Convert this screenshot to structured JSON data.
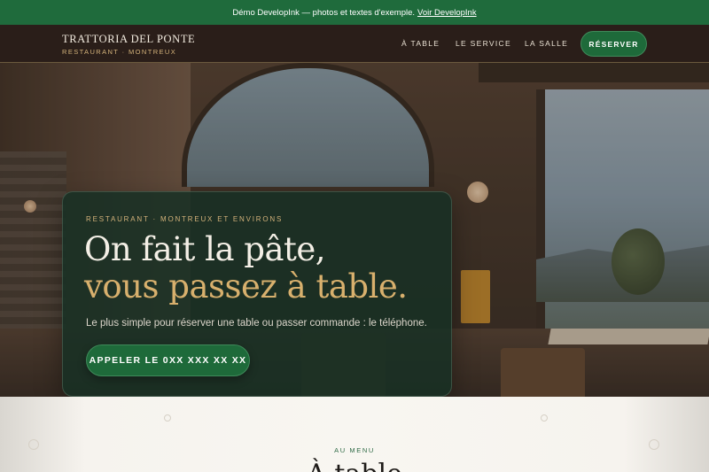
{
  "demo_banner": {
    "text": "Démo DevelopInk — photos et textes d'exemple.",
    "link": "Voir DevelopInk"
  },
  "header": {
    "brand_name": "TRATTORIA DEL PONTE",
    "brand_sub": "RESTAURANT · MONTREUX",
    "nav": [
      "À TABLE",
      "LE SERVICE",
      "LA SALLE"
    ],
    "reserve": "RÉSERVER"
  },
  "hero": {
    "eyebrow": "RESTAURANT · MONTREUX ET ENVIRONS",
    "title_line1": "On fait la pâte,",
    "title_line2": "vous passez à table.",
    "lead": "Le plus simple pour réserver une table ou passer commande : le téléphone.",
    "cta": "APPELER LE 0XX XXX XX XX"
  },
  "menu_section": {
    "eyebrow": "AU MENU",
    "title": "À table"
  },
  "colors": {
    "brand_green": "#1e6a3a",
    "gold": "#d8b06d",
    "header_bg": "#2a1e19"
  }
}
